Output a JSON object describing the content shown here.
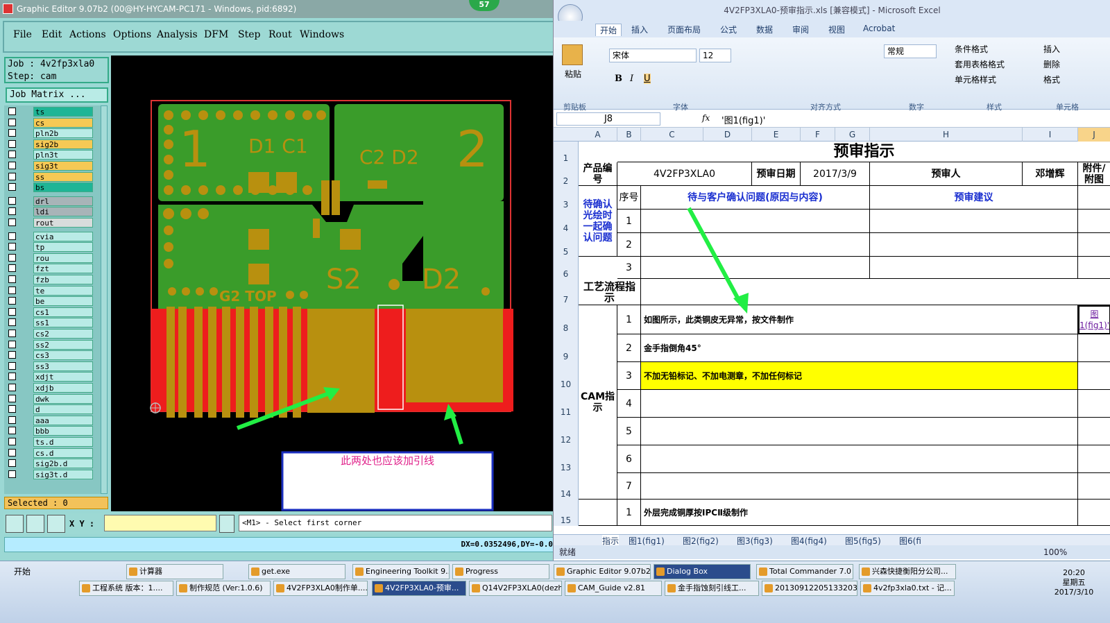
{
  "graphic_editor": {
    "title": "Graphic Editor 9.07b2 (00@HY-HYCAM-PC171 - Windows, pid:6892)",
    "badge": "57",
    "menu": [
      "File",
      "Edit",
      "Actions",
      "Options",
      "Analysis",
      "DFM",
      "Step",
      "Rout",
      "Windows"
    ],
    "job_line": "Job : 4v2fp3xla0",
    "step_line": "Step: cam",
    "job_matrix": "Job Matrix ...",
    "layers": [
      {
        "name": "ts",
        "color": "#1fb596"
      },
      {
        "name": "cs",
        "color": "#f6c955"
      },
      {
        "name": "pln2b",
        "color": "#b9ebe6"
      },
      {
        "name": "sig2b",
        "color": "#f6c955"
      },
      {
        "name": "pln3t",
        "color": "#b9ebe6"
      },
      {
        "name": "sig3t",
        "color": "#f6c955"
      },
      {
        "name": "ss",
        "color": "#f6c955"
      },
      {
        "name": "bs",
        "color": "#1fb596"
      },
      {
        "name": "drl",
        "color": "#a8b4b8"
      },
      {
        "name": "ldi",
        "color": "#a8b4b8"
      },
      {
        "name": "rout",
        "color": "#d8dcdc"
      },
      {
        "name": "cvia",
        "color": "#b9ebe6"
      },
      {
        "name": "tp",
        "color": "#b9ebe6"
      },
      {
        "name": "rou",
        "color": "#b9ebe6"
      },
      {
        "name": "fzt",
        "color": "#b9ebe6"
      },
      {
        "name": "fzb",
        "color": "#b9ebe6"
      },
      {
        "name": "te",
        "color": "#b9ebe6"
      },
      {
        "name": "be",
        "color": "#b9ebe6"
      },
      {
        "name": "cs1",
        "color": "#b9ebe6"
      },
      {
        "name": "ss1",
        "color": "#b9ebe6"
      },
      {
        "name": "cs2",
        "color": "#b9ebe6"
      },
      {
        "name": "ss2",
        "color": "#b9ebe6"
      },
      {
        "name": "cs3",
        "color": "#b9ebe6"
      },
      {
        "name": "ss3",
        "color": "#b9ebe6"
      },
      {
        "name": "xdjt",
        "color": "#b9ebe6"
      },
      {
        "name": "xdjb",
        "color": "#b9ebe6"
      },
      {
        "name": "dwk",
        "color": "#b9ebe6"
      },
      {
        "name": "d",
        "color": "#b9ebe6"
      },
      {
        "name": "aaa",
        "color": "#b9ebe6"
      },
      {
        "name": "bbb",
        "color": "#b9ebe6"
      },
      {
        "name": "ts.d",
        "color": "#b9ebe6"
      },
      {
        "name": "cs.d",
        "color": "#b9ebe6"
      },
      {
        "name": "sig2b.d",
        "color": "#b9ebe6"
      },
      {
        "name": "sig3t.d",
        "color": "#b9ebe6"
      }
    ],
    "selected": "Selected : 0",
    "xy_label": "X Y :",
    "prompt": "<M1> - Select first corner",
    "status": "DX=0.0352496,DY=-0.0",
    "board_labels": {
      "n1": "1",
      "n2": "2",
      "d1c1": "D1 C1",
      "c2d2": "C2 D2",
      "s2": "S2",
      "d2": "D2",
      "g2top": "G2 TOP"
    },
    "callout_text": "此两处也应该加引线"
  },
  "excel": {
    "title": "4V2FP3XLA0-预审指示.xls [兼容模式] - Microsoft Excel",
    "tabs": [
      "开始",
      "插入",
      "页面布局",
      "公式",
      "数据",
      "审阅",
      "视图",
      "Acrobat"
    ],
    "font_name": "宋体",
    "font_size": "12",
    "number_format": "常规",
    "groups": [
      "剪贴板",
      "字体",
      "对齐方式",
      "数字",
      "样式",
      "单元格"
    ],
    "paste_label": "粘贴",
    "style_items": [
      "条件格式",
      "套用表格格式",
      "单元格样式"
    ],
    "cell_items": [
      "插入",
      "删除",
      "格式"
    ],
    "name_box": "J8",
    "formula": "'图1(fig1)'",
    "fx": "fx",
    "columns": [
      "A",
      "B",
      "C",
      "D",
      "E",
      "F",
      "G",
      "H",
      "I",
      "J"
    ],
    "rows": [
      "1",
      "2",
      "3",
      "4",
      "5",
      "6",
      "7",
      "8",
      "9",
      "10",
      "11",
      "12",
      "13",
      "14",
      "15"
    ],
    "sheet_title": "预审指示",
    "product_no_label": "产品编号",
    "product_no": "4V2FP3XLA0",
    "review_date_label": "预审日期",
    "review_date": "2017/3/9",
    "reviewer_label": "预审人",
    "reviewer": "邓增辉",
    "attachment_label": "附件/附图",
    "seq_label": "序号",
    "pending_header": "待与客户确认问题(原因与内容)",
    "advice_header": "预审建议",
    "pending_label": "待确认光绘时一起确认问题",
    "process_label": "工艺流程指示",
    "cam_label": "CAM指示",
    "seq": [
      "1",
      "2",
      "3",
      "4",
      "5",
      "6",
      "7",
      "1"
    ],
    "cam_items": [
      "如图所示，此类铜皮无异常，按文件制作",
      "金手指倒角45°",
      "不加无铅标记、不加电测章，不加任何标记",
      "",
      "",
      "",
      ""
    ],
    "row15_text": "外层完成铜厚按IPCⅡ级制作",
    "link": "图1(fig1)'",
    "sheet_tabs": [
      "指示",
      "图1(fig1)",
      "图2(fig2)",
      "图3(fig3)",
      "图4(fig4)",
      "图5(fig5)",
      "图6(fi"
    ],
    "status": "就绪",
    "zoom": "100%"
  },
  "taskbar": {
    "start": "开始",
    "row1": [
      "计算器",
      "get.exe",
      "Engineering Toolkit 9....",
      "Progress",
      "Graphic Editor 9.07b2 ...",
      "Dialog Box",
      "Total Commander 7.0 ...",
      "兴森快捷衡阳分公司..."
    ],
    "row2": [
      "工程系统  版本：1....",
      "制作规范 (Ver:1.0.6)",
      "4V2FP3XLA0制作单....",
      "4V2FP3XLA0-预审...",
      "Q14V2FP3XLA0(dezh...",
      "CAM_Guide v2.81",
      "金手指蚀刻引线工...",
      "20130912205133203...",
      "4v2fp3xla0.txt - 记..."
    ],
    "time": "20:20",
    "weekday": "星期五",
    "date": "2017/3/10"
  }
}
